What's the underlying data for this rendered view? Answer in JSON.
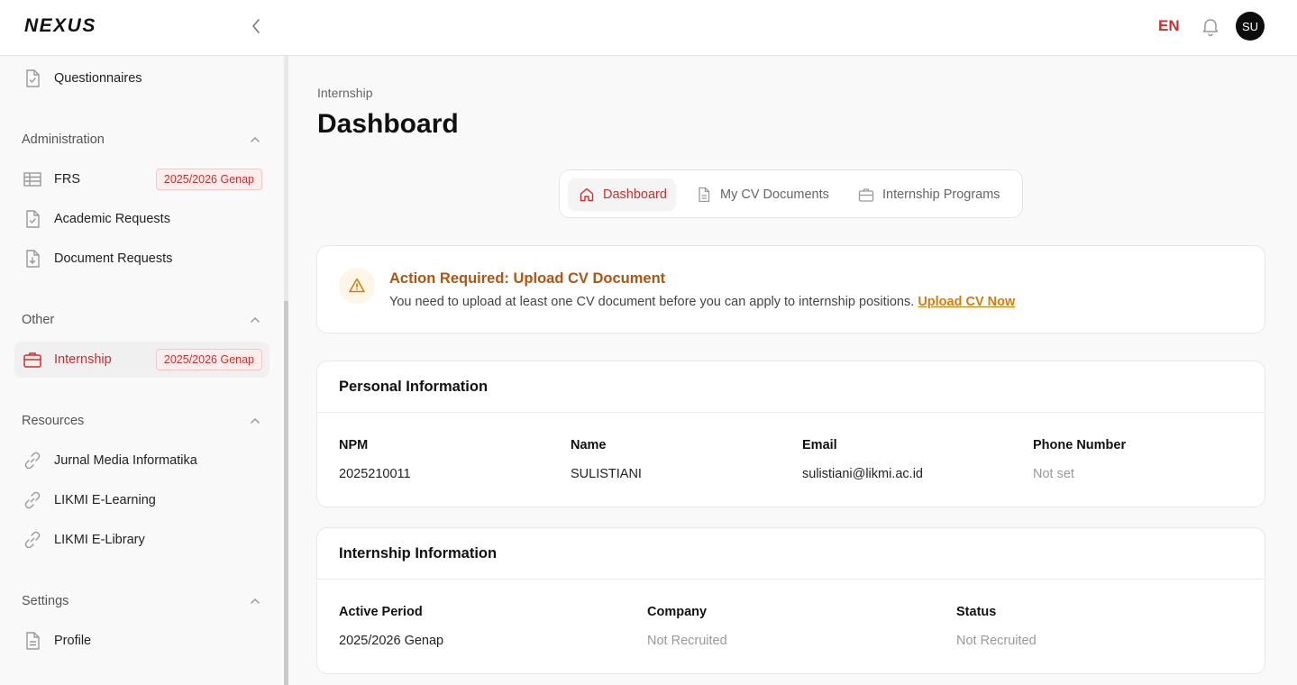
{
  "app": {
    "logo": "NEXUS"
  },
  "header": {
    "language": "EN",
    "avatar_initials": "SU"
  },
  "sidebar": {
    "top_items": [
      {
        "label": "Questionnaires",
        "icon": "document-check-icon"
      }
    ],
    "sections": [
      {
        "title": "Administration",
        "items": [
          {
            "label": "FRS",
            "icon": "table-icon",
            "badge": "2025/2026 Genap"
          },
          {
            "label": "Academic Requests",
            "icon": "document-check-icon"
          },
          {
            "label": "Document Requests",
            "icon": "document-download-icon"
          }
        ]
      },
      {
        "title": "Other",
        "items": [
          {
            "label": "Internship",
            "icon": "briefcase-icon",
            "badge": "2025/2026 Genap",
            "active": true
          }
        ]
      },
      {
        "title": "Resources",
        "items": [
          {
            "label": "Jurnal Media Informatika",
            "icon": "link-icon"
          },
          {
            "label": "LIKMI E-Learning",
            "icon": "link-icon"
          },
          {
            "label": "LIKMI E-Library",
            "icon": "link-icon"
          }
        ]
      },
      {
        "title": "Settings",
        "items": [
          {
            "label": "Profile",
            "icon": "document-icon"
          }
        ]
      }
    ]
  },
  "main": {
    "breadcrumb": "Internship",
    "title": "Dashboard",
    "tabs": [
      {
        "label": "Dashboard",
        "icon": "home-icon",
        "active": true
      },
      {
        "label": "My CV Documents",
        "icon": "document-icon"
      },
      {
        "label": "Internship Programs",
        "icon": "briefcase-icon"
      }
    ],
    "alert": {
      "title": "Action Required: Upload CV Document",
      "message": "You need to upload at least one CV document before you can apply to internship positions.",
      "link": "Upload CV Now",
      "icon": "warning-icon"
    },
    "personal": {
      "title": "Personal Information",
      "fields": [
        {
          "label": "NPM",
          "value": "2025210011"
        },
        {
          "label": "Name",
          "value": "SULISTIANI"
        },
        {
          "label": "Email",
          "value": "sulistiani@likmi.ac.id"
        },
        {
          "label": "Phone Number",
          "value": "Not set",
          "muted": true
        }
      ]
    },
    "internship": {
      "title": "Internship Information",
      "fields": [
        {
          "label": "Active Period",
          "value": "2025/2026 Genap"
        },
        {
          "label": "Company",
          "value": "Not Recruited",
          "muted": true
        },
        {
          "label": "Status",
          "value": "Not Recruited",
          "muted": true
        }
      ]
    }
  },
  "colors": {
    "accent": "#d62b2b",
    "warning": "#b4540c",
    "warning_link": "#d97a06"
  }
}
